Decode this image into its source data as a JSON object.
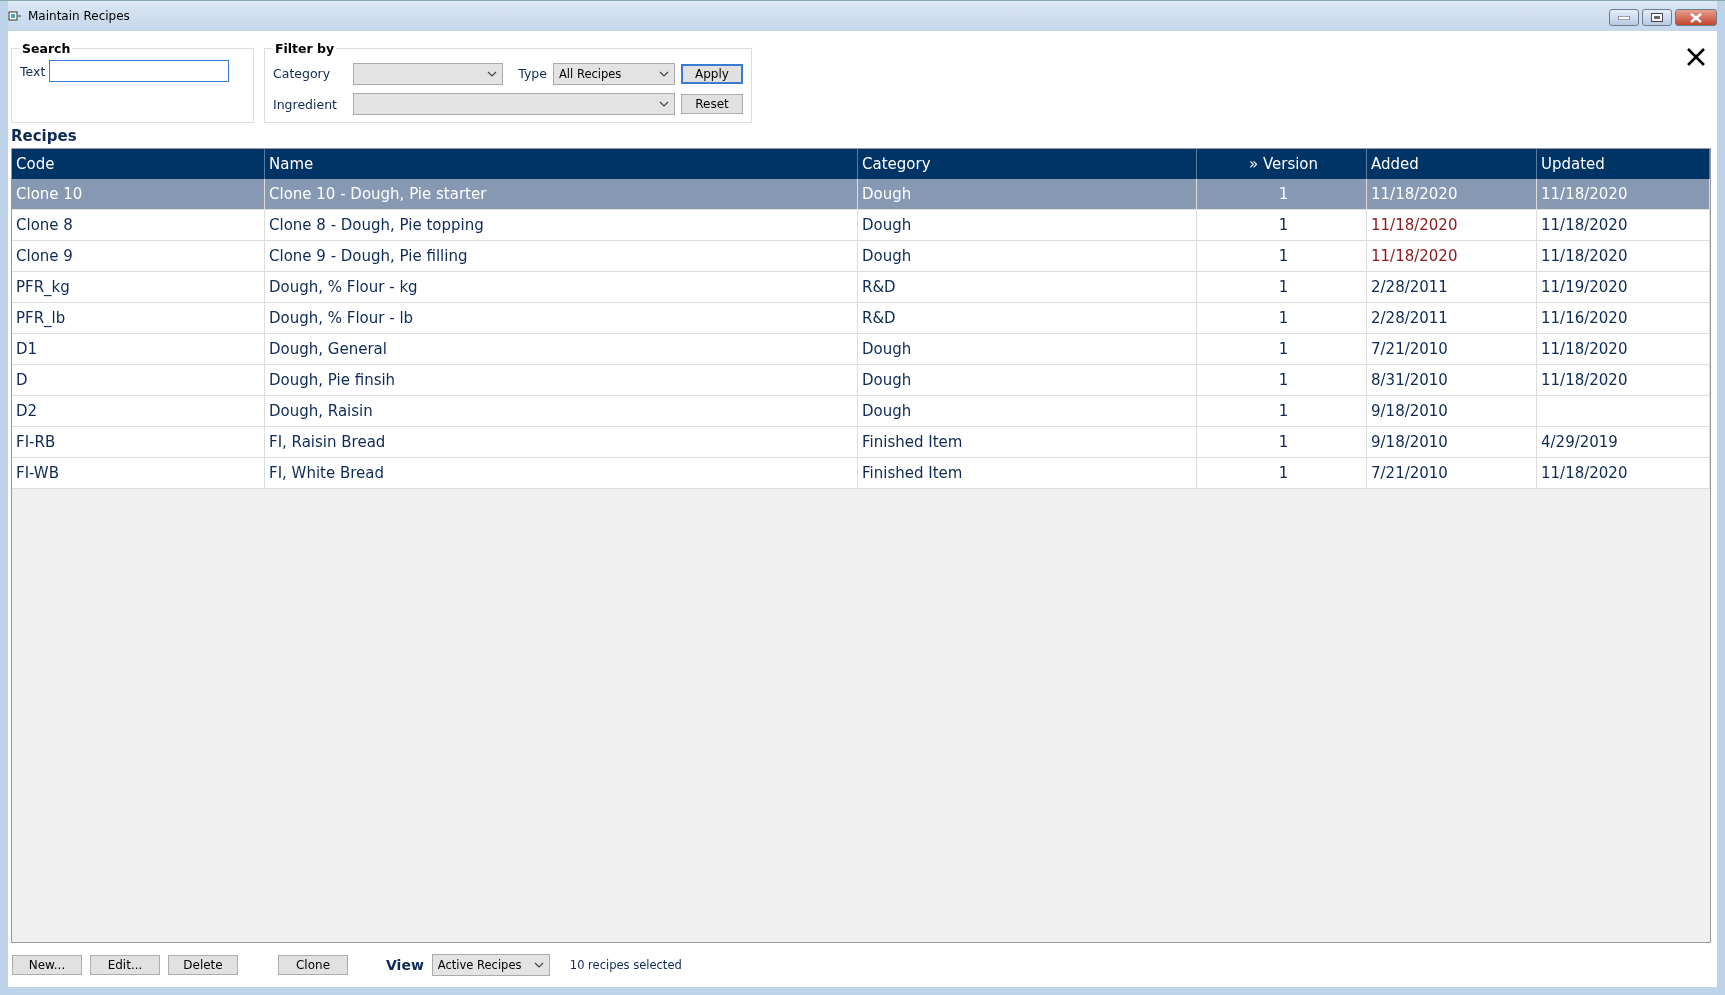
{
  "window": {
    "title": "Maintain Recipes"
  },
  "search": {
    "title": "Search",
    "label": "Text"
  },
  "filter": {
    "title": "Filter by",
    "category_label": "Category",
    "type_label": "Type",
    "type_value": "All Recipes",
    "ingredient_label": "Ingredient",
    "apply": "Apply",
    "reset": "Reset"
  },
  "table": {
    "title": "Recipes",
    "columns": [
      "Code",
      "Name",
      "Category",
      "» Version",
      "Added",
      "Updated"
    ],
    "rows": [
      {
        "selected": true,
        "added_highlight": true,
        "cells": [
          "Clone 10",
          "Clone 10 - Dough, Pie starter",
          "Dough",
          "1",
          "11/18/2020",
          "11/18/2020"
        ]
      },
      {
        "selected": false,
        "added_highlight": true,
        "cells": [
          "Clone 8",
          "Clone 8 - Dough, Pie topping",
          "Dough",
          "1",
          "11/18/2020",
          "11/18/2020"
        ]
      },
      {
        "selected": false,
        "added_highlight": true,
        "cells": [
          "Clone 9",
          "Clone 9 - Dough, Pie filling",
          "Dough",
          "1",
          "11/18/2020",
          "11/18/2020"
        ]
      },
      {
        "selected": false,
        "added_highlight": false,
        "cells": [
          "PFR_kg",
          "Dough, % Flour - kg",
          "R&D",
          "1",
          "2/28/2011",
          "11/19/2020"
        ]
      },
      {
        "selected": false,
        "added_highlight": false,
        "cells": [
          "PFR_lb",
          "Dough, % Flour - lb",
          "R&D",
          "1",
          "2/28/2011",
          "11/16/2020"
        ]
      },
      {
        "selected": false,
        "added_highlight": false,
        "cells": [
          "D1",
          "Dough, General",
          "Dough",
          "1",
          "7/21/2010",
          "11/18/2020"
        ]
      },
      {
        "selected": false,
        "added_highlight": false,
        "cells": [
          "D",
          "Dough, Pie finsih",
          "Dough",
          "1",
          "8/31/2010",
          "11/18/2020"
        ]
      },
      {
        "selected": false,
        "added_highlight": false,
        "cells": [
          "D2",
          "Dough, Raisin",
          "Dough",
          "1",
          "9/18/2010",
          ""
        ]
      },
      {
        "selected": false,
        "added_highlight": false,
        "cells": [
          "FI-RB",
          "FI, Raisin Bread",
          "Finished Item",
          "1",
          "9/18/2010",
          "4/29/2019"
        ]
      },
      {
        "selected": false,
        "added_highlight": false,
        "cells": [
          "FI-WB",
          "FI, White Bread",
          "Finished Item",
          "1",
          "7/21/2010",
          "11/18/2020"
        ]
      }
    ]
  },
  "footer": {
    "buttons": [
      "New...",
      "Edit...",
      "Delete"
    ],
    "clone": "Clone",
    "view_label": "View",
    "view_value": "Active Recipes",
    "status": "10 recipes selected"
  }
}
